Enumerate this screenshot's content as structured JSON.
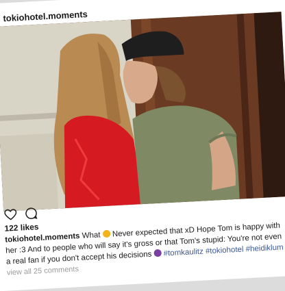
{
  "post": {
    "username": "tokiohotel.moments",
    "likes": "122 likes",
    "caption": {
      "user": "tokiohotel.moments",
      "part1": "What",
      "part2": "Never expected that xD Hope Tom is happy with her :3 And to",
      "part3": "people who will say it's gross or that Tom's stupid: You're not even a real fan if you don't accept",
      "part4": "his decisions",
      "hashtags": [
        "#tomkaulitz",
        "#tokiohotel",
        "#heidiklum"
      ]
    },
    "view_all": "view all 25 comments"
  },
  "icons": {
    "like": "heart-icon",
    "comment": "comment-bubble-icon",
    "emoji1": "thinking-face-emoji-icon",
    "emoji2": "purple-face-emoji-icon"
  },
  "colors": {
    "hashtag": "#3b5998",
    "muted": "#9a9a9a"
  }
}
